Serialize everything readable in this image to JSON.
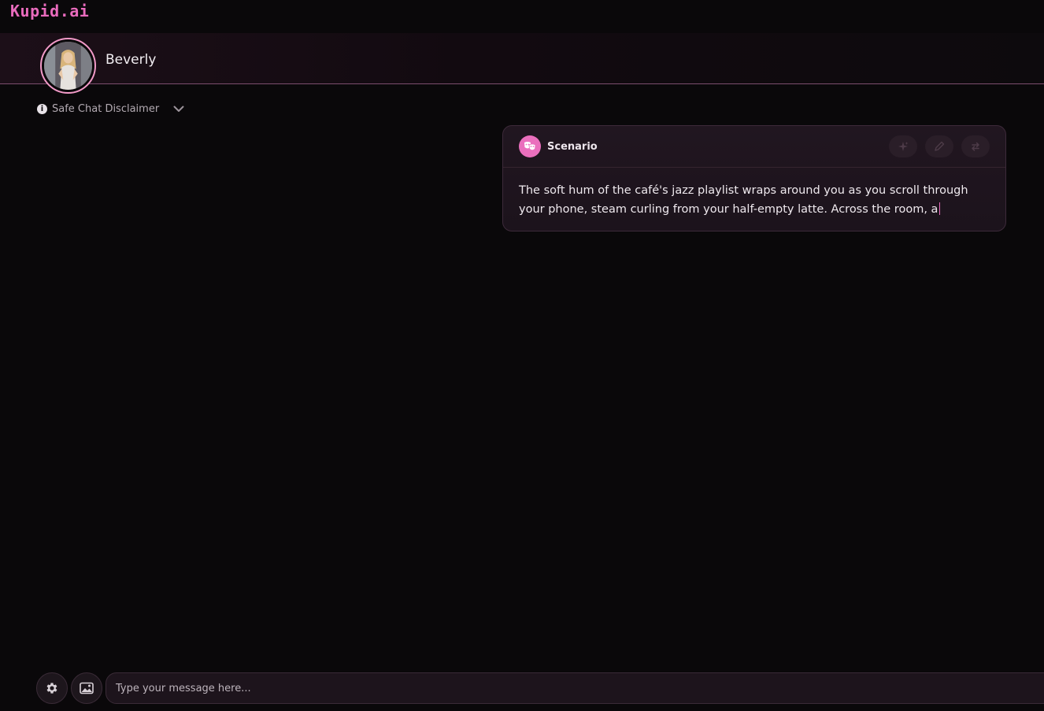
{
  "app": {
    "logo_text": "Kupid.ai"
  },
  "header": {
    "character_name": "Beverly"
  },
  "disclaimer": {
    "label": "Safe Chat Disclaimer"
  },
  "scenario": {
    "title": "Scenario",
    "text": "The soft hum of the café's jazz playlist wraps around you as you scroll through your phone, steam curling from your half-empty latte. Across the room, a"
  },
  "composer": {
    "placeholder": "Type your message here..."
  },
  "colors": {
    "accent": "#e96bbd",
    "background": "#0a080a",
    "card": "#211620"
  },
  "icons": [
    "info-icon",
    "chevron-down-icon",
    "theater-mask-icon",
    "sparkle-icon",
    "pencil-icon",
    "regenerate-icon",
    "gear-icon",
    "image-icon"
  ]
}
